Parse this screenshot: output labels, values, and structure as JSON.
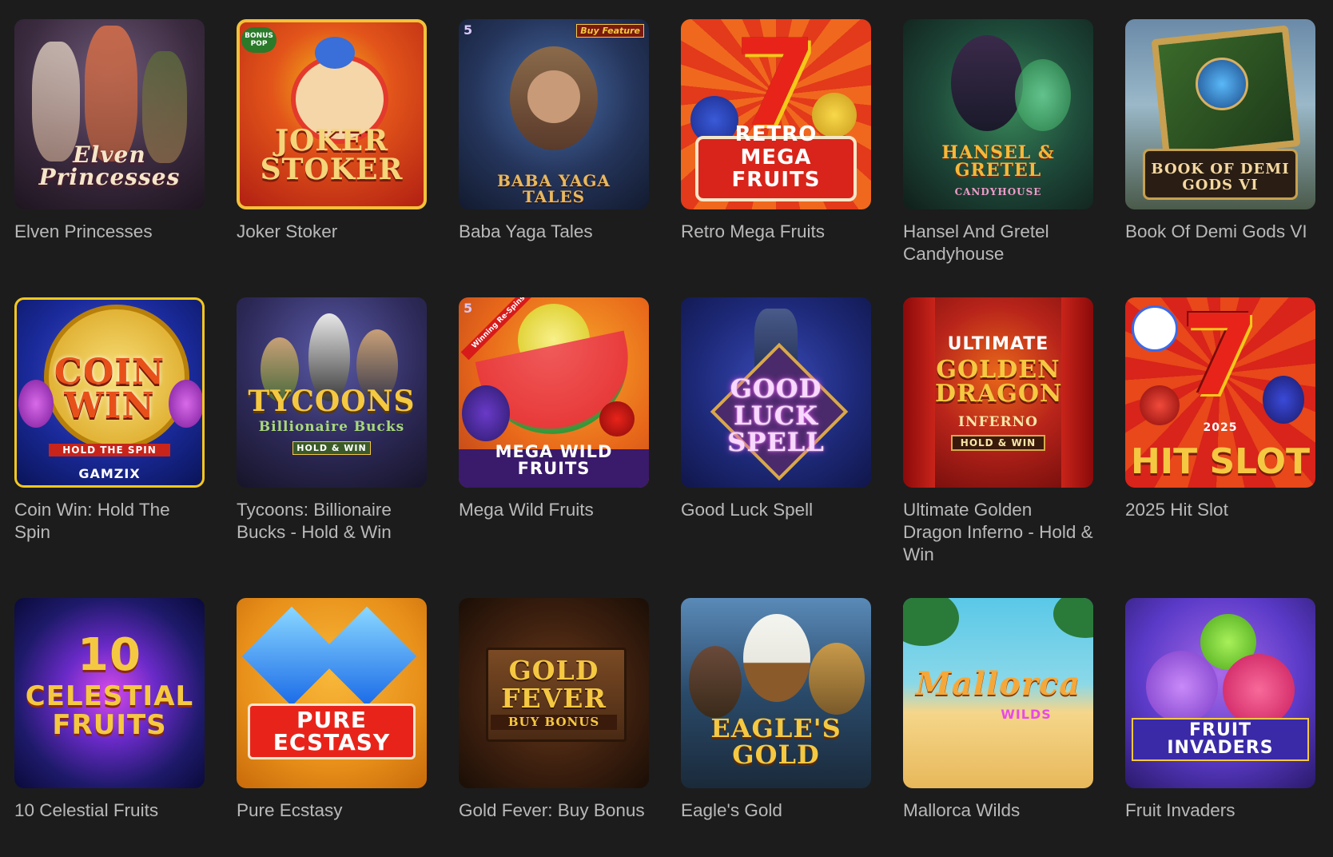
{
  "games": [
    {
      "id": "elven",
      "title": "Elven Princesses",
      "art": "Elven Princesses"
    },
    {
      "id": "joker",
      "title": "Joker Stoker",
      "art": "Joker Stoker",
      "badge": "BONUS POP"
    },
    {
      "id": "baba",
      "title": "Baba Yaga Tales",
      "art": "Baba Yaga Tales",
      "badge": "Buy Feature",
      "badge2": "5"
    },
    {
      "id": "retro",
      "title": "Retro Mega Fruits",
      "art": "Retro Mega Fruits"
    },
    {
      "id": "hansel",
      "title": "Hansel And Gretel Candyhouse",
      "art": "Hansel & Gretel",
      "art2": "Candyhouse"
    },
    {
      "id": "book",
      "title": "Book Of Demi Gods VI",
      "art": "Book of Demi Gods VI"
    },
    {
      "id": "coin",
      "title": "Coin Win: Hold The Spin",
      "art": "Coin Win",
      "art2": "Hold the Spin",
      "art3": "GAMZIX"
    },
    {
      "id": "tycoons",
      "title": "Tycoons: Billionaire Bucks - Hold & Win",
      "art": "Tycoons",
      "art2": "Billionaire Bucks",
      "art3": "Hold & Win"
    },
    {
      "id": "megawild",
      "title": "Mega Wild Fruits",
      "art": "Mega Wild Fruits",
      "badge": "Winning Re-Spins",
      "badge2": "5"
    },
    {
      "id": "goodluck",
      "title": "Good Luck Spell",
      "art": "Good Luck Spell"
    },
    {
      "id": "dragon",
      "title": "Ultimate Golden Dragon Inferno - Hold & Win",
      "art": "Ultimate",
      "art2": "Golden Dragon",
      "art3": "Inferno",
      "art4": "Hold & Win"
    },
    {
      "id": "hitslot",
      "title": "2025 Hit Slot",
      "art": "Hit Slot",
      "art2": "2025"
    },
    {
      "id": "celestial",
      "title": "10 Celestial Fruits",
      "art": "10",
      "art2": "Celestial Fruits"
    },
    {
      "id": "ecstasy",
      "title": "Pure Ecstasy",
      "art": "Pure Ecstasy"
    },
    {
      "id": "goldfever",
      "title": "Gold Fever: Buy Bonus",
      "art": "Gold Fever",
      "art2": "Buy Bonus"
    },
    {
      "id": "eagle",
      "title": "Eagle's Gold",
      "art": "Eagle's Gold"
    },
    {
      "id": "mallorca",
      "title": "Mallorca Wilds",
      "art": "Mallorca",
      "art2": "Wilds"
    },
    {
      "id": "invaders",
      "title": "Fruit Invaders",
      "art": "Fruit Invaders"
    }
  ],
  "colors": {
    "background": "#1c1c1c",
    "label": "#b9b9b9"
  }
}
